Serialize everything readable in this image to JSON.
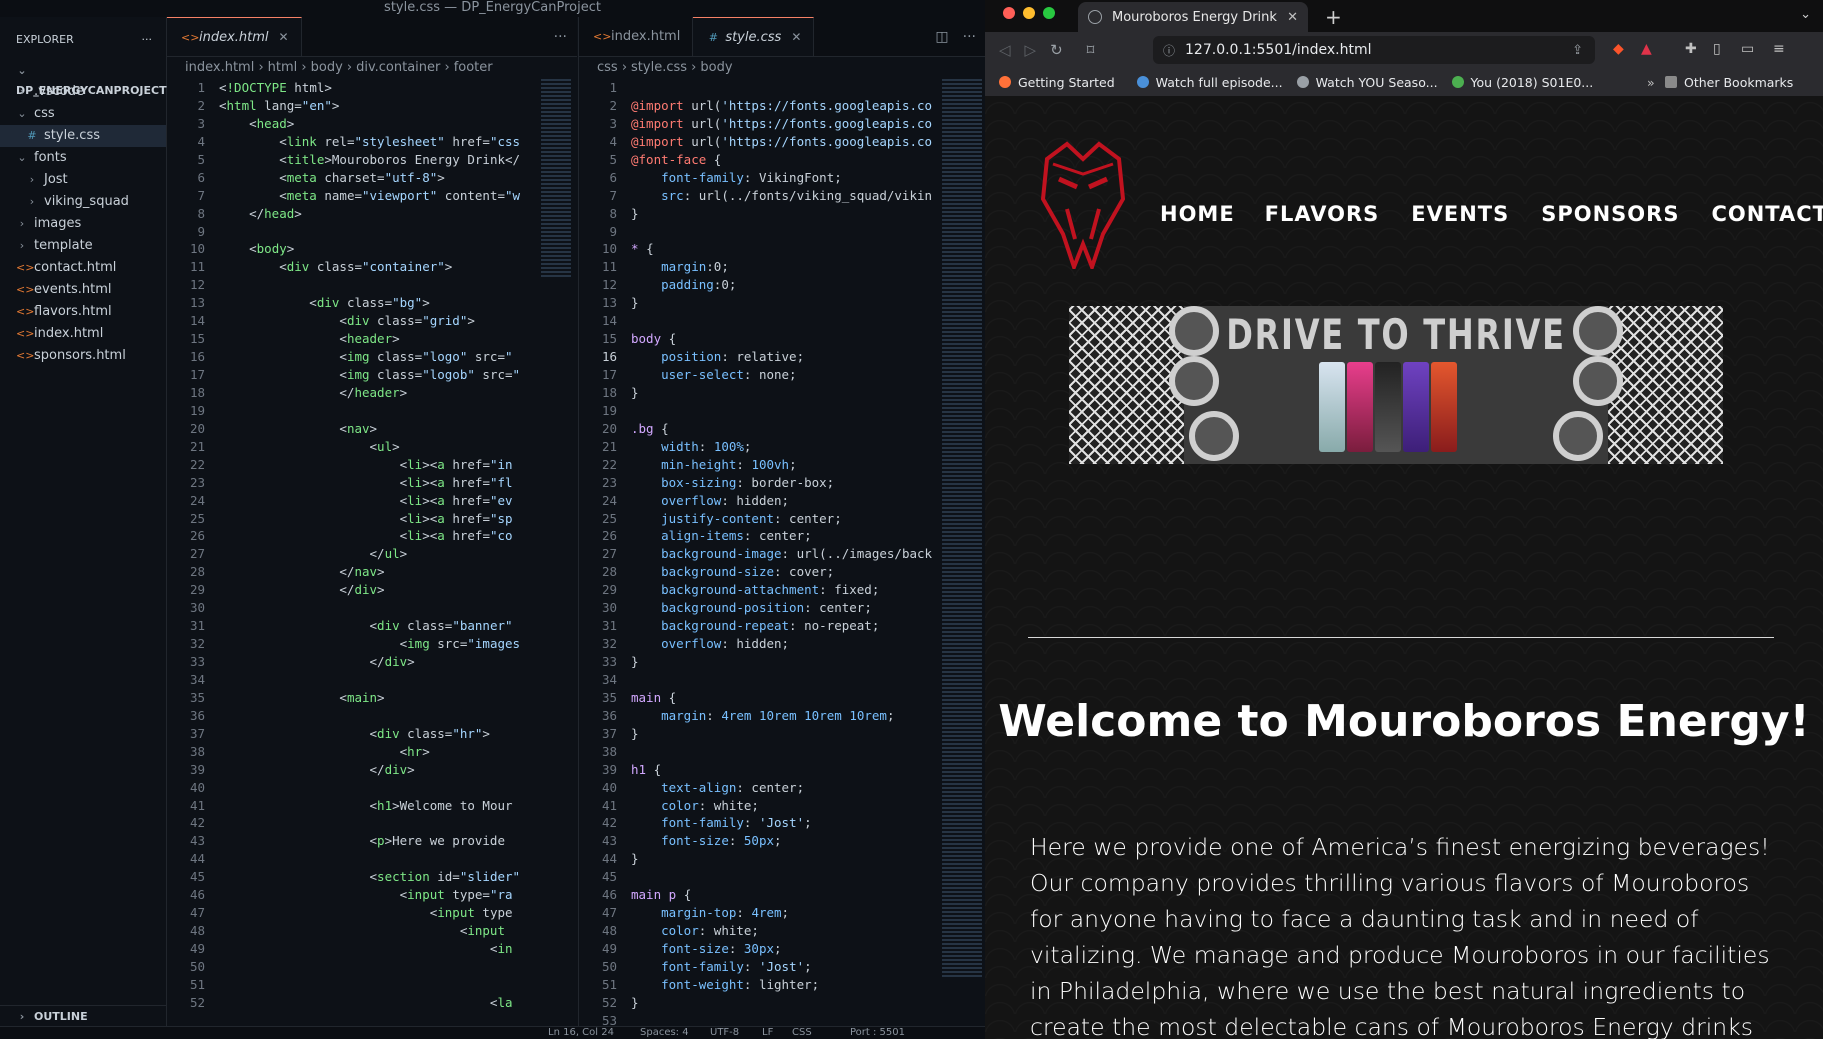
{
  "vscode": {
    "window_title": "style.css — DP_EnergyCanProject",
    "explorer_label": "EXPLORER",
    "project_name": "DP_ENERGYCANPROJECT",
    "tree": [
      {
        "label": ".vscode",
        "type": "folder",
        "open": false,
        "indent": 1
      },
      {
        "label": "css",
        "type": "folder",
        "open": true,
        "indent": 1
      },
      {
        "label": "style.css",
        "type": "css",
        "indent": 2,
        "active": true
      },
      {
        "label": "fonts",
        "type": "folder",
        "open": true,
        "indent": 1
      },
      {
        "label": "Jost",
        "type": "folder",
        "open": false,
        "indent": 2
      },
      {
        "label": "viking_squad",
        "type": "folder",
        "open": false,
        "indent": 2
      },
      {
        "label": "images",
        "type": "folder",
        "open": false,
        "indent": 1
      },
      {
        "label": "template",
        "type": "folder",
        "open": false,
        "indent": 1
      },
      {
        "label": "contact.html",
        "type": "html",
        "indent": 1
      },
      {
        "label": "events.html",
        "type": "html",
        "indent": 1
      },
      {
        "label": "flavors.html",
        "type": "html",
        "indent": 1
      },
      {
        "label": "index.html",
        "type": "html",
        "indent": 1
      },
      {
        "label": "sponsors.html",
        "type": "html",
        "indent": 1
      }
    ],
    "outline_label": "OUTLINE",
    "editor1": {
      "tab_label": "index.html",
      "breadcrumb": [
        "index.html",
        "html",
        "body",
        "div.container",
        "footer"
      ],
      "lines": [
        "<!DOCTYPE html>",
        "<html lang=\"en\">",
        "    <head>",
        "        <link rel=\"stylesheet\" href=\"css",
        "        <title>Mouroboros Energy Drink</",
        "        <meta charset=\"utf-8\">",
        "        <meta name=\"viewport\" content=\"w",
        "    </head>",
        "",
        "    <body>",
        "        <div class=\"container\">",
        "",
        "            <div class=\"bg\">",
        "                <div class=\"grid\">",
        "                <header>",
        "                <img class=\"logo\" src=\"",
        "                <img class=\"logob\" src=\"",
        "                </header>",
        "",
        "                <nav>",
        "                    <ul>",
        "                        <li><a href=\"in",
        "                        <li><a href=\"fl",
        "                        <li><a href=\"ev",
        "                        <li><a href=\"sp",
        "                        <li><a href=\"co",
        "                    </ul>",
        "                </nav>",
        "                </div>",
        "",
        "                    <div class=\"banner\"",
        "                        <img src=\"images",
        "                    </div>",
        "",
        "                <main>",
        "",
        "                    <div class=\"hr\">",
        "                        <hr>",
        "                    </div>",
        "",
        "                    <h1>Welcome to Mour",
        "",
        "                    <p>Here we provide",
        "",
        "                    <section id=\"slider\"",
        "                        <input type=\"ra",
        "                            <input type",
        "                                <input",
        "                                    <in",
        "",
        "",
        "                                    <la"
      ]
    },
    "editor2": {
      "tab_inactive_label": "index.html",
      "tab_label": "style.css",
      "breadcrumb": [
        "css",
        "style.css",
        "body"
      ],
      "current_line": 16,
      "lines": [
        "",
        "@import url('https://fonts.googleapis.co",
        "@import url('https://fonts.googleapis.co",
        "@import url('https://fonts.googleapis.co",
        "@font-face {",
        "    font-family: VikingFont;",
        "    src: url(../fonts/viking_squad/vikin",
        "}",
        "",
        "* {",
        "    margin:0;",
        "    padding:0;",
        "}",
        "",
        "body {",
        "    position: relative;",
        "    user-select: none;",
        "}",
        "",
        ".bg {",
        "    width: 100%;",
        "    min-height: 100vh;",
        "    box-sizing: border-box;",
        "    overflow: hidden;",
        "    justify-content: center;",
        "    align-items: center;",
        "    background-image: url(../images/back",
        "    background-size: cover;",
        "    background-attachment: fixed;",
        "    background-position: center;",
        "    background-repeat: no-repeat;",
        "    overflow: hidden;",
        "}",
        "",
        "main {",
        "    margin: 4rem 10rem 10rem 10rem;",
        "}",
        "",
        "h1 {",
        "    text-align: center;",
        "    color: white;",
        "    font-family: 'Jost';",
        "    font-size: 50px;",
        "}",
        "",
        "main p {",
        "    margin-top: 4rem;",
        "    color: white;",
        "    font-size: 30px;",
        "    font-family: 'Jost';",
        "    font-weight: lighter;",
        "}",
        ""
      ]
    },
    "status": {
      "position": "Ln 16, Col 24",
      "spaces": "Spaces: 4",
      "encoding": "UTF-8",
      "eol": "LF",
      "language": "CSS",
      "port": "Port : 5501"
    }
  },
  "browser": {
    "tab_title": "Mouroboros Energy Drink",
    "url": "127.0.0.1:5501/index.html",
    "bookmarks": [
      "Getting Started",
      "Watch full episode...",
      "Watch YOU Seaso...",
      "You (2018) S01E0..."
    ],
    "other_bookmarks": "Other Bookmarks",
    "site": {
      "nav": [
        "HOME",
        "FLAVORS",
        "EVENTS",
        "SPONSORS",
        "CONTACT"
      ],
      "banner_text": "DRIVE TO THRIVE",
      "heading": "Welcome to Mouroboros Energy!",
      "intro": "Here we provide one of America’s finest energizing beverages! Our company provides thrilling various flavors of Mouroboros for anyone having to face a daunting task and in need of vitalizing. We manage and produce Mouroboros in our facilities in Philadelphia, where we use the best natural ingredients to create the most delectable cans of Mouroboros Energy drinks for your satisfaction!"
    }
  },
  "colors": {
    "accent": "#f78166",
    "logo_red": "#c1121f",
    "bg_dark": "#0d1117"
  }
}
